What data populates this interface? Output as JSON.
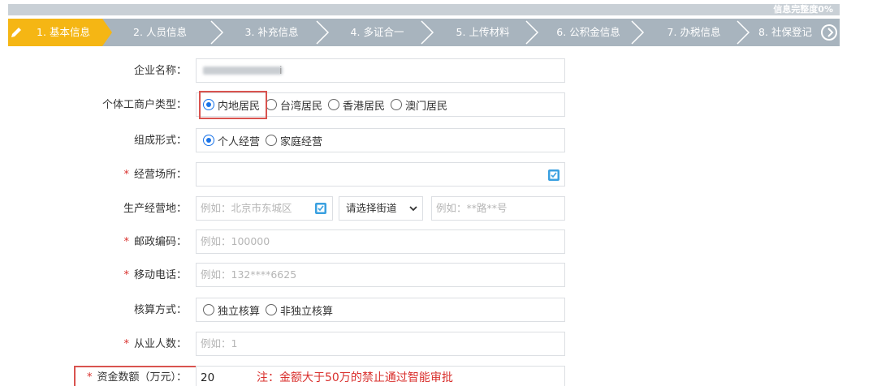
{
  "progress": {
    "label": "信息完整度0%",
    "value_percent": 0
  },
  "steps": [
    {
      "label": "1. 基本信息",
      "active": true
    },
    {
      "label": "2. 人员信息",
      "active": false
    },
    {
      "label": "3. 补充信息",
      "active": false
    },
    {
      "label": "4. 多证合一",
      "active": false
    },
    {
      "label": "5. 上传材料",
      "active": false
    },
    {
      "label": "6. 公积金信息",
      "active": false
    },
    {
      "label": "7. 办税信息",
      "active": false
    },
    {
      "label": "8. 社保登记",
      "active": false
    }
  ],
  "form": {
    "company_name": {
      "label": "企业名称：",
      "value_suffix": "i"
    },
    "household_type": {
      "label": "个体工商户类型：",
      "options": [
        "内地居民",
        "台湾居民",
        "香港居民",
        "澳门居民"
      ],
      "selected": "内地居民"
    },
    "composition": {
      "label": "组成形式：",
      "options": [
        "个人经营",
        "家庭经营"
      ],
      "selected": "个人经营"
    },
    "business_place": {
      "label": "经营场所：",
      "required": "*",
      "value": ""
    },
    "production_site": {
      "label": "生产经营地：",
      "placeholder_area": "例如：北京市东城区",
      "street_select": "请选择街道",
      "placeholder_road": "例如：**路**号"
    },
    "postal_code": {
      "label": "邮政编码：",
      "required": "*",
      "placeholder": "例如：100000"
    },
    "mobile": {
      "label": "移动电话：",
      "required": "*",
      "placeholder": "例如：132****6625"
    },
    "accounting": {
      "label": "核算方式：",
      "options": [
        "独立核算",
        "非独立核算"
      ],
      "selected": ""
    },
    "employees": {
      "label": "从业人数：",
      "required": "*",
      "placeholder": "例如：1"
    },
    "capital": {
      "label": "资金数额（万元）：",
      "required": "*",
      "value": "20",
      "note": "注：金额大于50万的禁止通过智能审批"
    }
  },
  "colors": {
    "accent": "#f5b614",
    "step_bg": "#a8b4be",
    "highlight": "#d9534f",
    "radio": "#1a73e8",
    "required": "#d9302d"
  }
}
